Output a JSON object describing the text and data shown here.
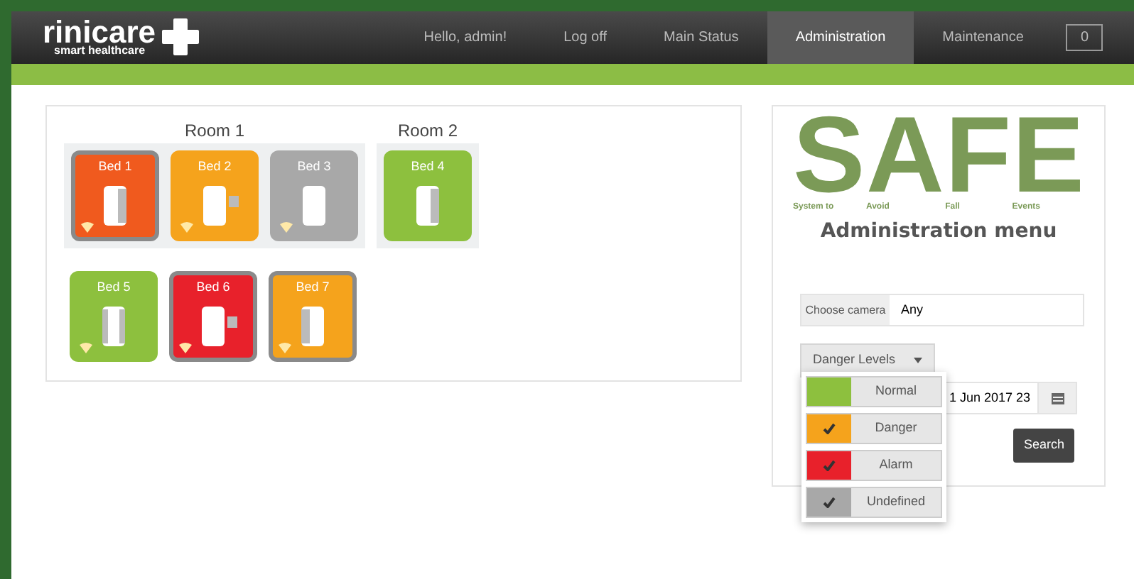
{
  "brand": {
    "name": "rinicare",
    "tagline": "smart healthcare"
  },
  "nav": [
    {
      "label": "Hello, admin!",
      "selected": false
    },
    {
      "label": "Log off",
      "selected": false
    },
    {
      "label": "Main Status",
      "selected": false
    },
    {
      "label": "Administration",
      "selected": true
    },
    {
      "label": "Maintenance",
      "selected": false
    }
  ],
  "counter": "0",
  "rooms": [
    {
      "title": "Room 1",
      "beds": [
        {
          "name": "Bed 1",
          "color": "#f05a1e",
          "alarm": true,
          "kind": "side",
          "wifi": true
        },
        {
          "name": "Bed 2",
          "color": "#f5a31c",
          "alarm": false,
          "kind": "square",
          "wifi": true
        },
        {
          "name": "Bed 3",
          "color": "#a8a8a8",
          "alarm": false,
          "kind": "plain",
          "wifi": true
        }
      ]
    },
    {
      "title": "Room 2",
      "beds": [
        {
          "name": "Bed 4",
          "color": "#8dc03e",
          "alarm": false,
          "kind": "side",
          "wifi": false
        }
      ]
    }
  ],
  "other_beds": [
    {
      "name": "Bed 5",
      "color": "#8dc03e",
      "alarm": false,
      "kind": "both",
      "wifi": true
    },
    {
      "name": "Bed 6",
      "color": "#e8212b",
      "alarm": true,
      "kind": "square",
      "wifi": true
    },
    {
      "name": "Bed 7",
      "color": "#f5a31c",
      "alarm": true,
      "kind": "left",
      "wifi": true
    }
  ],
  "logo": {
    "letters": [
      "S",
      "A",
      "F",
      "E"
    ],
    "words": [
      "System to",
      "Avoid",
      "Fall",
      "Events"
    ]
  },
  "panel_title": "Administration menu",
  "camera": {
    "label": "Choose camera",
    "value": "Any"
  },
  "danger_button": "Danger Levels",
  "levels": [
    {
      "label": "Normal",
      "color": "#8dc03e",
      "checked": false
    },
    {
      "label": "Danger",
      "color": "#f5a31c",
      "checked": true
    },
    {
      "label": "Alarm",
      "color": "#e8212b",
      "checked": true
    },
    {
      "label": "Undefined",
      "color": "#a8a8a8",
      "checked": true
    }
  ],
  "date_value": "1 Jun 2017 23",
  "search_button": "Search"
}
